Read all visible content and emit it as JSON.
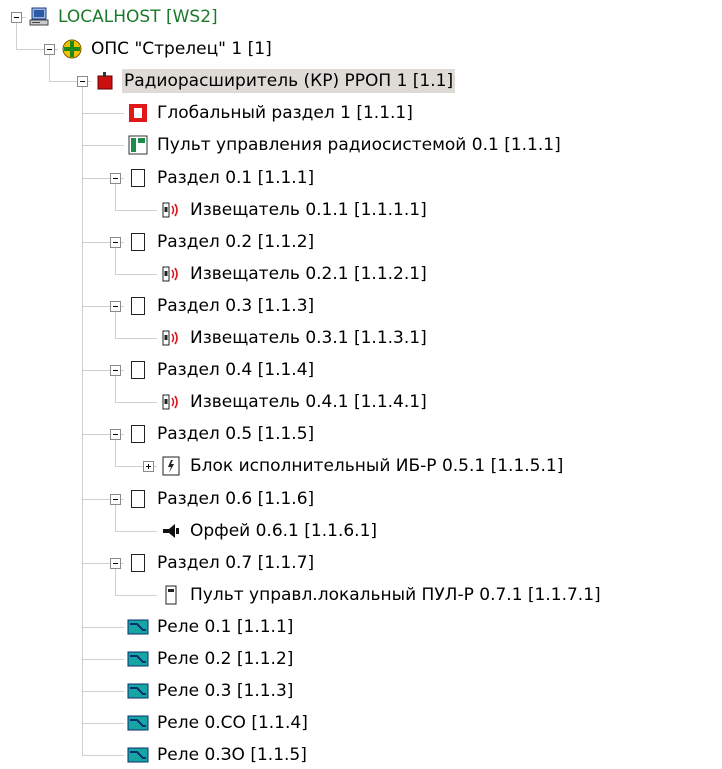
{
  "tree": {
    "nodes": [
      {
        "label": "LOCALHOST [WS2]",
        "icon": "computer-icon",
        "depth": 0,
        "expander": "minus",
        "style": "host"
      },
      {
        "label": "ОПС \"Стрелец\" 1 [1]",
        "icon": "strelets-system-icon",
        "depth": 1,
        "expander": "minus"
      },
      {
        "label": "Радиорасширитель (КР) РРОП 1 [1.1]",
        "icon": "radio-expander-icon",
        "depth": 2,
        "expander": "minus",
        "selected": true
      },
      {
        "label": "Глобальный раздел 1 [1.1.1]",
        "icon": "global-section-icon",
        "depth": 3
      },
      {
        "label": "Пульт управления радиосистемой 0.1 [1.1.1]",
        "icon": "control-panel-icon",
        "depth": 3
      },
      {
        "label": "Раздел 0.1 [1.1.1]",
        "icon": "section-icon",
        "depth": 3,
        "expander": "minus"
      },
      {
        "label": "Извещатель 0.1.1 [1.1.1.1]",
        "icon": "detector-icon",
        "depth": 4
      },
      {
        "label": "Раздел 0.2 [1.1.2]",
        "icon": "section-icon",
        "depth": 3,
        "expander": "minus"
      },
      {
        "label": "Извещатель 0.2.1 [1.1.2.1]",
        "icon": "detector-icon",
        "depth": 4
      },
      {
        "label": "Раздел 0.3 [1.1.3]",
        "icon": "section-icon",
        "depth": 3,
        "expander": "minus"
      },
      {
        "label": "Извещатель 0.3.1 [1.1.3.1]",
        "icon": "detector-icon",
        "depth": 4
      },
      {
        "label": "Раздел 0.4 [1.1.4]",
        "icon": "section-icon",
        "depth": 3,
        "expander": "minus"
      },
      {
        "label": "Извещатель 0.4.1 [1.1.4.1]",
        "icon": "detector-icon",
        "depth": 4
      },
      {
        "label": "Раздел 0.5 [1.1.5]",
        "icon": "section-icon",
        "depth": 3,
        "expander": "minus"
      },
      {
        "label": "Блок исполнительный ИБ-Р 0.5.1 [1.1.5.1]",
        "icon": "executive-block-icon",
        "depth": 4,
        "expander": "plus"
      },
      {
        "label": "Раздел 0.6 [1.1.6]",
        "icon": "section-icon",
        "depth": 3,
        "expander": "minus"
      },
      {
        "label": "Орфей 0.6.1 [1.1.6.1]",
        "icon": "siren-icon",
        "depth": 4
      },
      {
        "label": "Раздел 0.7 [1.1.7]",
        "icon": "section-icon",
        "depth": 3,
        "expander": "minus"
      },
      {
        "label": "Пульт управл.локальный ПУЛ-Р 0.7.1 [1.1.7.1]",
        "icon": "local-panel-icon",
        "depth": 4
      },
      {
        "label": "Реле 0.1 [1.1.1]",
        "icon": "relay-icon",
        "depth": 3
      },
      {
        "label": "Реле 0.2 [1.1.2]",
        "icon": "relay-icon",
        "depth": 3
      },
      {
        "label": "Реле 0.3 [1.1.3]",
        "icon": "relay-icon",
        "depth": 3
      },
      {
        "label": "Реле 0.СО [1.1.4]",
        "icon": "relay-icon",
        "depth": 3
      },
      {
        "label": "Реле 0.ЗО [1.1.5]",
        "icon": "relay-icon",
        "depth": 3
      }
    ]
  },
  "colors": {
    "host_text": "#1a7a2a",
    "selection_bg": "#dedad5",
    "section_red": "#e01818",
    "relay_teal": "#17a6a6",
    "connector": "#a0a0a0"
  }
}
